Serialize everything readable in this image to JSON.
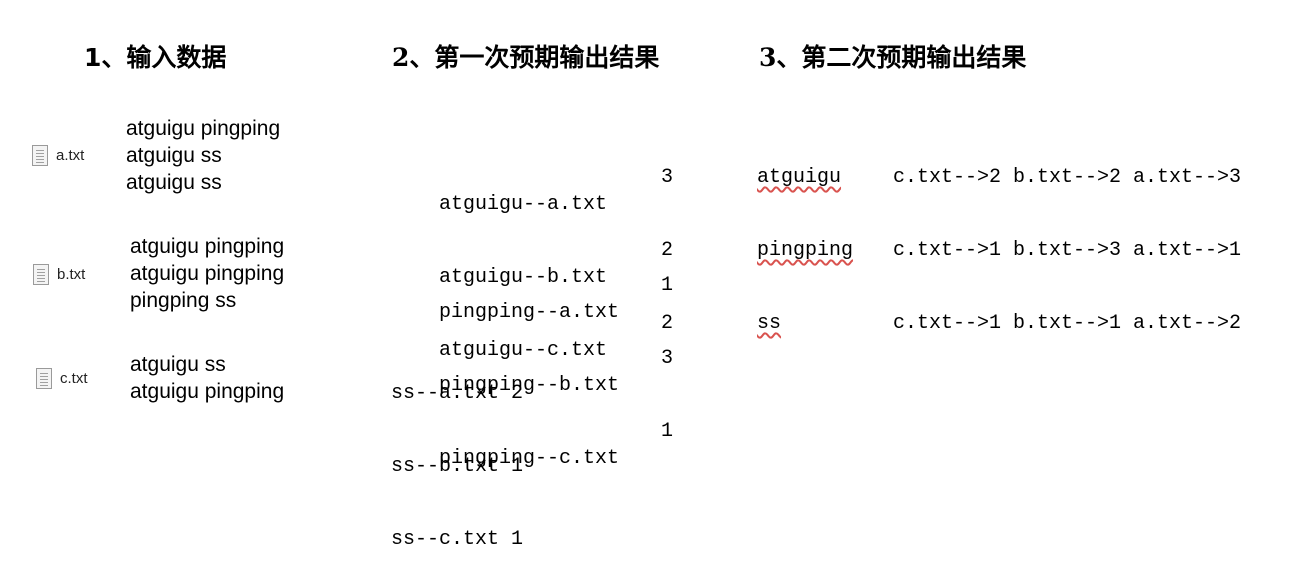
{
  "headings": {
    "input": "1、输入数据",
    "first": "2、第一次预期输出结果",
    "second": "3、第二次预期输出结果"
  },
  "files": [
    {
      "name": "a.txt",
      "icon": "text-file-icon",
      "lines": [
        "atguigu pingping",
        "atguigu ss",
        "atguigu ss"
      ]
    },
    {
      "name": "b.txt",
      "icon": "text-file-icon",
      "lines": [
        "atguigu pingping",
        "atguigu pingping",
        "pingping ss"
      ]
    },
    {
      "name": "c.txt",
      "icon": "text-file-icon",
      "lines": [
        "atguigu ss",
        "atguigu pingping"
      ]
    }
  ],
  "first_output": [
    [
      {
        "key": "atguigu--a.txt",
        "count": "3"
      },
      {
        "key": "atguigu--b.txt",
        "count": "2"
      },
      {
        "key": "atguigu--c.txt",
        "count": "2"
      }
    ],
    [
      {
        "key": "pingping--a.txt",
        "count": "1"
      },
      {
        "key": "pingping--b.txt",
        "count": "3"
      },
      {
        "key": "pingping--c.txt",
        "count": "1"
      }
    ],
    [
      {
        "line": "ss--a.txt 2"
      },
      {
        "line": "ss--b.txt 1"
      },
      {
        "line": "ss--c.txt 1"
      }
    ]
  ],
  "second_output": [
    {
      "word": "atguigu",
      "list": "c.txt-->2 b.txt-->2 a.txt-->3"
    },
    {
      "word": "pingping",
      "list": "c.txt-->1 b.txt-->3 a.txt-->1"
    },
    {
      "word": "ss",
      "list": "c.txt-->1 b.txt-->1 a.txt-->2"
    }
  ]
}
